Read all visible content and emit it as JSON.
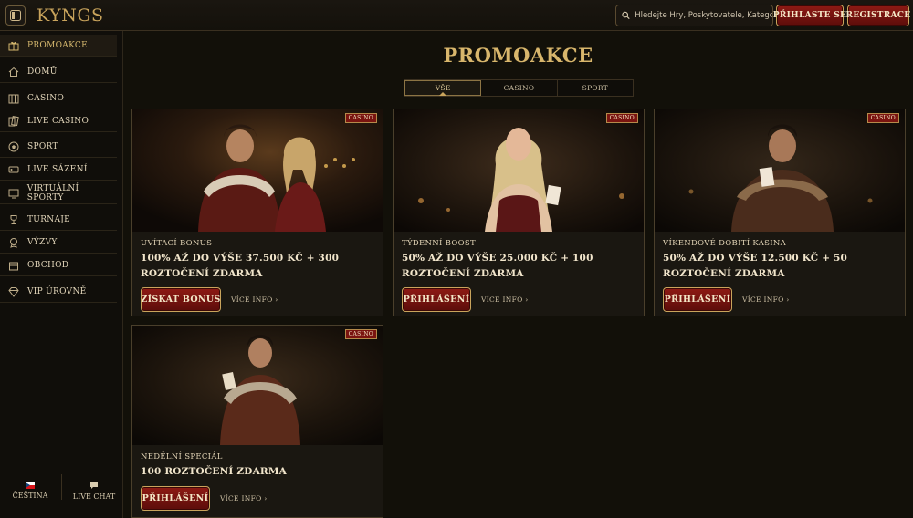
{
  "header": {
    "logo": "KYNGS",
    "search_placeholder": "Hledejte Hry, Poskytovatele, Kategorie",
    "login_label": "PŘIHLASTE SE",
    "register_label": "REGISTRACE"
  },
  "sidebar": {
    "items": [
      {
        "label": "PROMOAKCE",
        "icon": "gift-icon"
      },
      {
        "label": "DOMŮ",
        "icon": "home-icon"
      },
      {
        "label": "CASINO",
        "icon": "slot-icon"
      },
      {
        "label": "LIVE CASINO",
        "icon": "cards-icon"
      },
      {
        "label": "SPORT",
        "icon": "soccer-ball-icon"
      },
      {
        "label": "LIVE SÁZENÍ",
        "icon": "live-icon"
      },
      {
        "label": "VIRTUÁLNÍ SPORTY",
        "icon": "monitor-icon"
      },
      {
        "label": "TURNAJE",
        "icon": "trophy-icon"
      },
      {
        "label": "VÝZVY",
        "icon": "challenge-icon"
      },
      {
        "label": "OBCHOD",
        "icon": "shop-icon"
      },
      {
        "label": "VIP ÚROVNĚ",
        "icon": "diamond-icon"
      }
    ],
    "footer": {
      "language": "ČEŠTINA",
      "live_chat": "LIVE CHAT"
    }
  },
  "main": {
    "title": "PROMOAKCE",
    "tabs": [
      {
        "label": "VŠE",
        "active": true
      },
      {
        "label": "CASINO",
        "active": false
      },
      {
        "label": "SPORT",
        "active": false
      }
    ],
    "cards": [
      {
        "badge": "CASINO",
        "subtitle": "UVÍTACÍ BONUS",
        "title": "100% AŽ DO VÝŠE 37.500 KČ + 300 ROZTOČENÍ ZDARMA",
        "button": "ZÍSKAT BONUS",
        "more": "VÍCE INFO"
      },
      {
        "badge": "CASINO",
        "subtitle": "TÝDENNÍ BOOST",
        "title": "50% AŽ DO VÝŠE 25.000 KČ + 100 ROZTOČENÍ ZDARMA",
        "button": "PŘIHLÁŠENÍ",
        "more": "VÍCE INFO"
      },
      {
        "badge": "CASINO",
        "subtitle": "VÍKENDOVÉ DOBITÍ KASINA",
        "title": "50% AŽ DO VÝŠE 12.500 KČ + 50 ROZTOČENÍ ZDARMA",
        "button": "PŘIHLÁŠENÍ",
        "more": "VÍCE INFO"
      },
      {
        "badge": "CASINO",
        "subtitle": "NEDĚLNÍ SPECIÁL",
        "title": "100 ROZTOČENÍ ZDARMA",
        "button": "PŘIHLÁŠENÍ",
        "more": "VÍCE INFO"
      }
    ]
  },
  "colors": {
    "accent_gold": "#d8b66c",
    "button_red": "#8e1a14",
    "background": "#121009"
  }
}
